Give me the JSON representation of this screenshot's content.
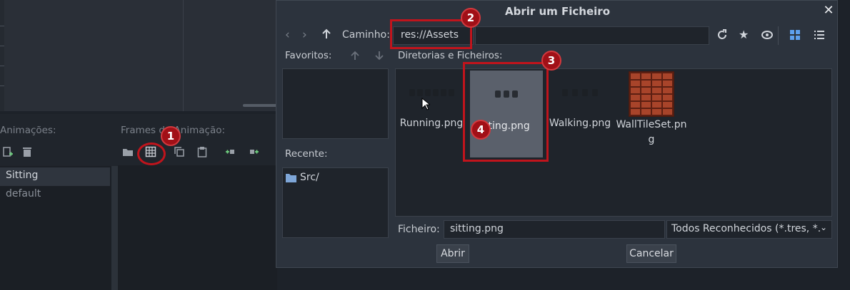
{
  "editor": {
    "animations_label": "Animações:",
    "frames_label": "Frames de Animação:",
    "animations": [
      "Sitting",
      "default"
    ]
  },
  "dialog": {
    "title": "Abrir um Ficheiro",
    "path_label": "Caminho:",
    "path_value": "res://Assets",
    "favorites_label": "Favoritos:",
    "recent_label": "Recente:",
    "recent_items": [
      "Src/"
    ],
    "files_label": "Diretorias e Ficheiros:",
    "files": [
      {
        "name": "Running.png"
      },
      {
        "name": "Sitting.png",
        "display": "tting.png",
        "selected": true
      },
      {
        "name": "Walking.png",
        "display": "Walking.png"
      },
      {
        "name": "WallTileSet.png",
        "line1": "WallTileSet.pn",
        "line2": "g"
      }
    ],
    "file_label": "Ficheiro:",
    "file_value": "sitting.png",
    "filter_value": "Todos Reconhecidos (*.tres, *.",
    "open_button": "Abrir",
    "cancel_button": "Cancelar"
  },
  "annotations": [
    "1",
    "2",
    "3",
    "4"
  ],
  "colors": {
    "accent": "#c0141c",
    "selected_file_bg": "#5a606b",
    "brick": "#a8442a"
  }
}
